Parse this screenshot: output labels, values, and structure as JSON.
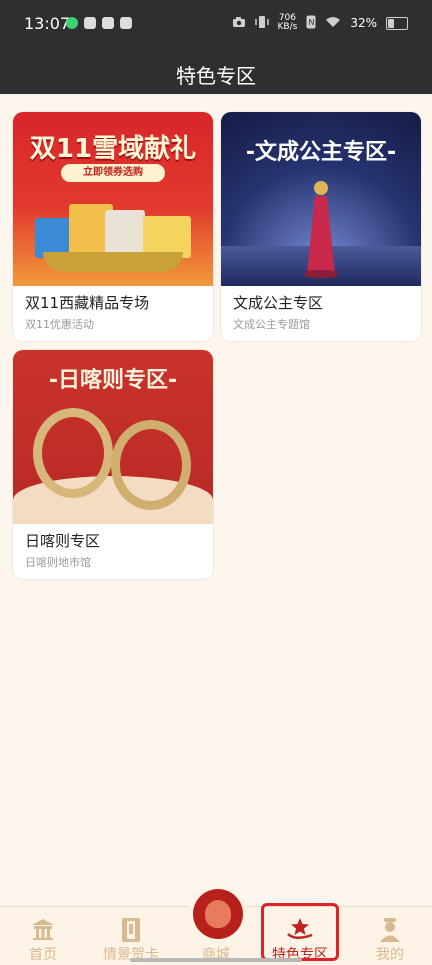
{
  "status_bar": {
    "time": "13:07",
    "network": "706\nKB/s",
    "battery": "32%"
  },
  "header": {
    "title": "特色专区"
  },
  "cards": [
    {
      "banner_text": "双11雪域献礼",
      "banner_button": "立即领券选购",
      "title": "双11西藏精品专场",
      "subtitle": "双11优惠活动"
    },
    {
      "banner_text": "-文成公主专区-",
      "title": "文成公主专区",
      "subtitle": "文成公主专题馆"
    },
    {
      "banner_text": "-日喀则专区-",
      "title": "日喀则专区",
      "subtitle": "日喀则地市馆"
    }
  ],
  "nav": [
    {
      "label": "首页",
      "icon": "temple-icon"
    },
    {
      "label": "情景贺卡",
      "icon": "card-icon"
    },
    {
      "label": "商城",
      "icon": "mall-icon"
    },
    {
      "label": "特色专区",
      "icon": "star-hand-icon"
    },
    {
      "label": "我的",
      "icon": "user-icon"
    }
  ],
  "colors": {
    "accent": "#c0241f",
    "nav_inactive": "#d9b98f",
    "header_bg": "#2f2f2f",
    "page_bg": "#fdf6ee",
    "highlight_border": "#e1202a"
  }
}
